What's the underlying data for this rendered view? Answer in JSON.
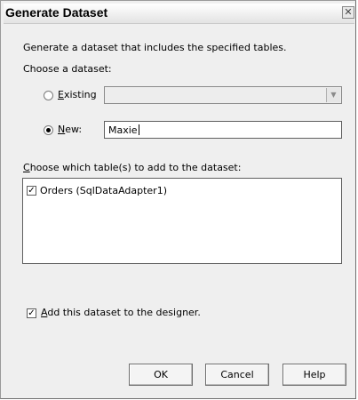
{
  "dialog": {
    "title": "Generate Dataset",
    "close_glyph": "✕",
    "description": "Generate a dataset that includes the specified tables.",
    "choose_dataset_label": "Choose a dataset:",
    "existing_option": {
      "accel": "E",
      "rest": "xisting",
      "selected": false
    },
    "existing_combo": {
      "value": "",
      "enabled": false,
      "arrow_glyph": "▼"
    },
    "new_option": {
      "accel": "N",
      "rest": "ew:",
      "selected": true
    },
    "new_name_value": "Maxie",
    "tables_label": {
      "accel": "C",
      "rest": "hoose which table(s) to add to the dataset:"
    },
    "tables": [
      {
        "label": "Orders (SqlDataAdapter1)",
        "checked": true
      }
    ],
    "add_to_designer": {
      "accel": "A",
      "rest": "dd this dataset to the designer.",
      "checked": true
    },
    "check_glyph": "✓",
    "buttons": {
      "ok": "OK",
      "cancel": "Cancel",
      "help": "Help"
    }
  }
}
